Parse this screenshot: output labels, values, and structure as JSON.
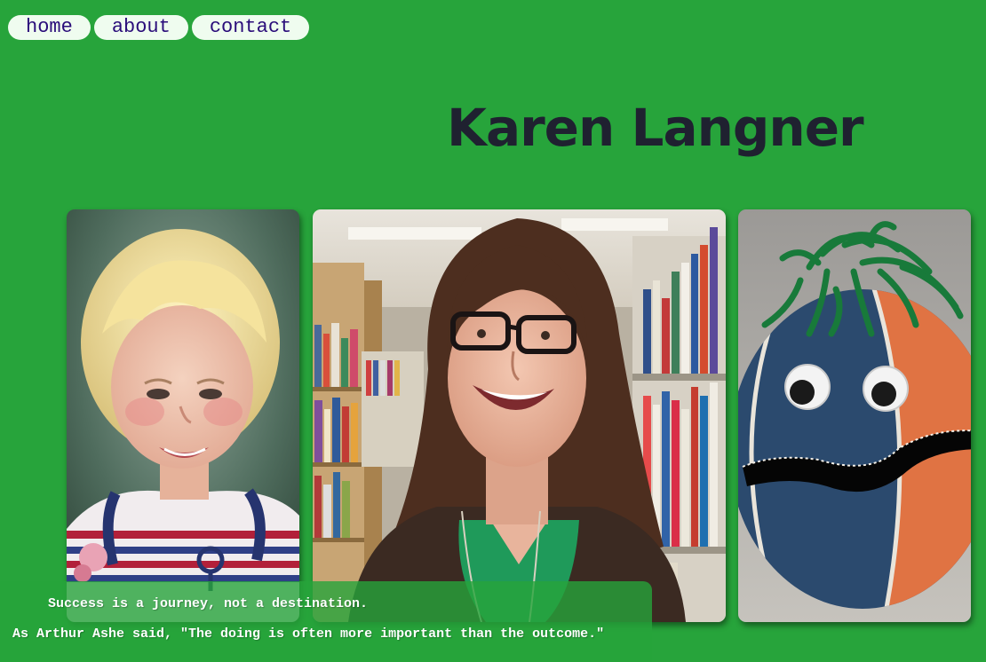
{
  "nav": {
    "items": [
      {
        "label": "home"
      },
      {
        "label": "about"
      },
      {
        "label": "contact"
      }
    ]
  },
  "header": {
    "title": "Karen Langner"
  },
  "gallery": {
    "images": [
      {
        "subject": "painted portrait of a smiling blonde toddler in a striped shirt"
      },
      {
        "subject": "photo of a smiling woman with glasses in a library aisle"
      },
      {
        "subject": "blue and orange ball decorated with googly eyes, green yarn hair and a cut mouth"
      }
    ]
  },
  "quote": {
    "line1": "Success is a journey, not a destination.",
    "line2": "As Arthur Ashe said, \"The doing is often more important than the outcome.\""
  },
  "colors": {
    "background": "#27a43b",
    "nav_pill": "#effcef",
    "nav_text": "#2a0d7a",
    "title": "#1f2130",
    "quote_text": "#ffffff"
  }
}
